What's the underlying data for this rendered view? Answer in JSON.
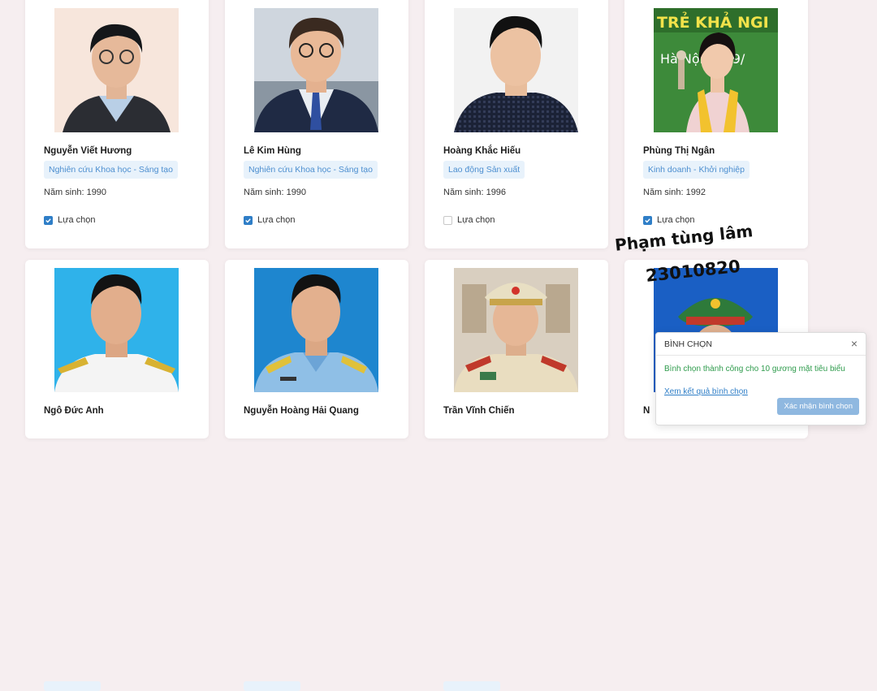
{
  "candidates": [
    {
      "name": "Nguyễn Viết Hương",
      "field": "Nghiên cứu Khoa học - Sáng tạo",
      "birth": "Năm sinh: 1990",
      "select_label": "Lựa chọn",
      "selected": true
    },
    {
      "name": "Lê Kim Hùng",
      "field": "Nghiên cứu Khoa học - Sáng tạo",
      "birth": "Năm sinh: 1990",
      "select_label": "Lựa chọn",
      "selected": true
    },
    {
      "name": "Hoàng Khắc Hiếu",
      "field": "Lao động Sản xuất",
      "birth": "Năm sinh: 1996",
      "select_label": "Lựa chọn",
      "selected": false
    },
    {
      "name": "Phùng Thị Ngân",
      "field": "Kinh doanh - Khởi nghiệp",
      "birth": "Năm sinh: 1992",
      "select_label": "Lựa chọn",
      "selected": true
    },
    {
      "name": "Ngô Đức Anh"
    },
    {
      "name": "Nguyễn Hoàng Hải Quang"
    },
    {
      "name": "Trần Vĩnh Chiến"
    },
    {
      "name": "N"
    }
  ],
  "photo4_banner": {
    "line1": "TRẺ KHẢ NGI",
    "line2": "Hà Nội, n 09/"
  },
  "handwriting": {
    "line1": "Phạm tùng lâm",
    "line2": "23010820"
  },
  "vote_dialog": {
    "title": "BÌNH CHỌN",
    "close": "×",
    "message": "Bình chọn thành công cho 10 gương mặt tiêu biểu",
    "link": "Xem kết quả bình chọn",
    "confirm_button": "Xác nhận bình chọn"
  },
  "colors": {
    "accent": "#2f7ec7",
    "tag_bg": "#e8f2fb",
    "success": "#2e9b4c"
  }
}
